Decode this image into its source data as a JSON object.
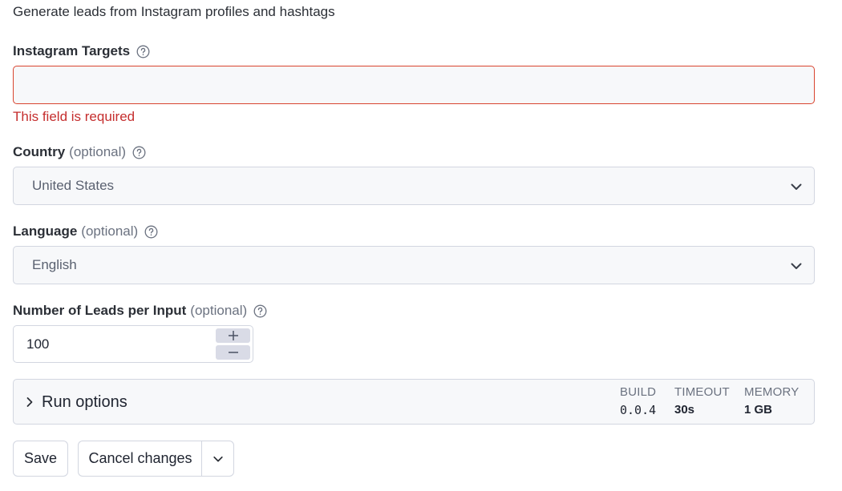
{
  "page": {
    "subtitle": "Generate leads from Instagram profiles and hashtags"
  },
  "fields": {
    "instagram_targets": {
      "label": "Instagram Targets",
      "value": "",
      "error": "This field is required"
    },
    "country": {
      "label": "Country",
      "optional": "(optional)",
      "selected": "United States"
    },
    "language": {
      "label": "Language",
      "optional": "(optional)",
      "selected": "English"
    },
    "leads_per_input": {
      "label": "Number of Leads per Input",
      "optional": "(optional)",
      "value": "100"
    }
  },
  "run_options": {
    "title": "Run options",
    "build_label": "BUILD",
    "build_value": "0.0.4",
    "timeout_label": "TIMEOUT",
    "timeout_value": "30s",
    "memory_label": "MEMORY",
    "memory_value": "1 GB"
  },
  "actions": {
    "save_label": "Save",
    "cancel_label": "Cancel changes"
  },
  "icons": {
    "help": "question-circle-icon",
    "chevron": "chevron-down-icon",
    "expand": "chevron-right-icon",
    "plus": "plus-icon",
    "minus": "minus-icon"
  },
  "colors": {
    "error": "#c52e2e",
    "error_border": "#d9442f",
    "field_bg": "#f7f8fa",
    "border": "#d2d6e0"
  }
}
